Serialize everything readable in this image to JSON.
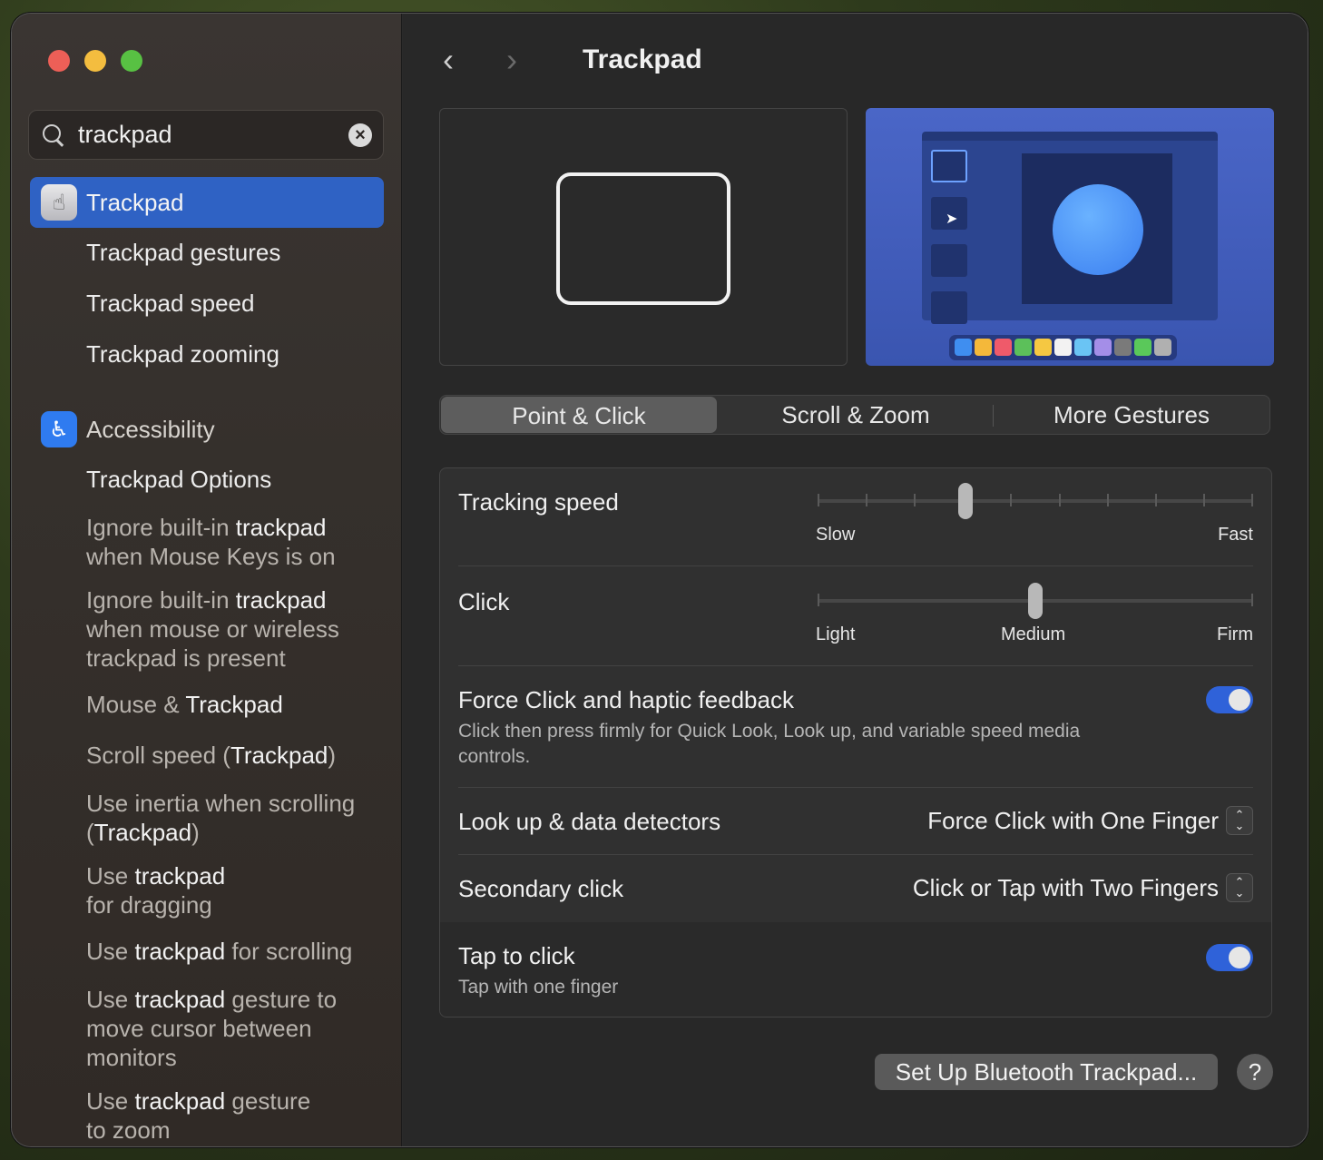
{
  "window": {
    "title": "Trackpad"
  },
  "search": {
    "value": "trackpad"
  },
  "sidebar": {
    "selected": "Trackpad",
    "sub_items": [
      "Trackpad gestures",
      "Trackpad speed",
      "Trackpad zooming"
    ],
    "section": "Accessibility",
    "access_items": {
      "options": "Trackpad Options",
      "ignore1": [
        "Ignore built-in ",
        "trackpad",
        "when Mouse Keys is on"
      ],
      "ignore2": [
        "Ignore built-in ",
        "trackpad",
        "when mouse or wireless",
        "trackpad is present"
      ],
      "mouse": [
        "Mouse & ",
        "Trackpad"
      ],
      "scroll": [
        "Scroll speed (",
        "Trackpad",
        ")"
      ],
      "inertia": [
        "Use inertia when scrolling",
        "(",
        "Trackpad",
        ")"
      ],
      "drag": [
        "Use ",
        "trackpad",
        "for dragging"
      ],
      "scrolling": [
        "Use ",
        "trackpad",
        " for scrolling"
      ],
      "gesture_move": [
        "Use ",
        "trackpad",
        " gesture to",
        "move cursor between",
        "monitors"
      ],
      "gesture_zoom": [
        "Use ",
        "trackpad",
        " gesture",
        "to zoom"
      ]
    }
  },
  "tabs": [
    "Point & Click",
    "Scroll & Zoom",
    "More Gestures"
  ],
  "active_tab": "Point & Click",
  "settings": {
    "tracking": {
      "label": "Tracking speed",
      "min": "Slow",
      "max": "Fast",
      "value_fraction": 0.34,
      "ticks": 10
    },
    "click": {
      "label": "Click",
      "min": "Light",
      "mid": "Medium",
      "max": "Firm",
      "value": "Medium"
    },
    "force_click": {
      "label": "Force Click and haptic feedback",
      "desc": "Click then press firmly for Quick Look, Look up, and variable speed media controls.",
      "enabled": true
    },
    "lookup": {
      "label": "Look up & data detectors",
      "value": "Force Click with One Finger"
    },
    "secondary": {
      "label": "Secondary click",
      "value": "Click or Tap with Two Fingers"
    },
    "tap": {
      "label": "Tap to click",
      "desc": "Tap with one finger",
      "enabled": true
    }
  },
  "buttons": {
    "bluetooth": "Set Up Bluetooth Trackpad...",
    "help": "?"
  },
  "colors": {
    "accent": "#2f62c4",
    "toggle_on": "#2f62d9"
  },
  "dock_colors": [
    "#3f8ef0",
    "#f4b83a",
    "#ef5a6a",
    "#5cc05a",
    "#f5c842",
    "#f2f2f2",
    "#6ac4f4",
    "#a48ee8",
    "#7a7a7a",
    "#5ac85a",
    "#b0b0b0"
  ]
}
